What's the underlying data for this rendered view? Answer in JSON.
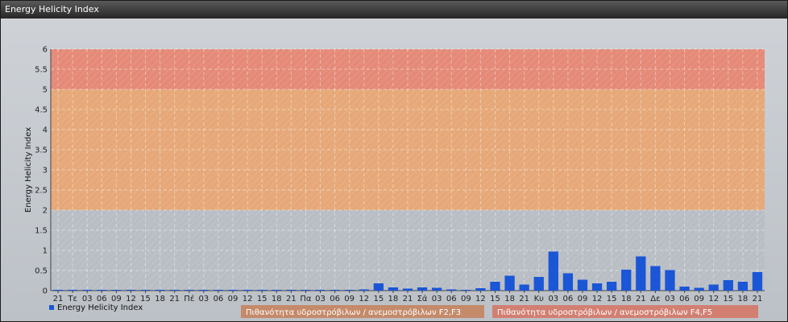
{
  "window": {
    "title": "Energy Helicity Index"
  },
  "chart_data": {
    "type": "bar",
    "ylabel": "Energy Helicity Index",
    "ylim": [
      0,
      6
    ],
    "yticks": [
      "0",
      "0.5",
      "1",
      "1.5",
      "2",
      "2.5",
      "3",
      "3.5",
      "4",
      "4.5",
      "5",
      "5.5",
      "6"
    ],
    "grid": true,
    "categories": [
      "21",
      "Τε",
      "03",
      "06",
      "09",
      "12",
      "15",
      "18",
      "21",
      "Πέ",
      "03",
      "06",
      "09",
      "12",
      "15",
      "18",
      "21",
      "Πα",
      "03",
      "06",
      "09",
      "12",
      "15",
      "18",
      "21",
      "Σά",
      "03",
      "06",
      "09",
      "12",
      "15",
      "18",
      "21",
      "Κυ",
      "03",
      "06",
      "09",
      "12",
      "15",
      "18",
      "21",
      "Δε",
      "03",
      "06",
      "09",
      "12",
      "15",
      "18",
      "21"
    ],
    "series": [
      {
        "name": "Energy Helicity Index",
        "color": "#1a56d6",
        "values": [
          0.02,
          0.02,
          0.02,
          0.02,
          0.02,
          0.02,
          0.02,
          0.02,
          0.02,
          0.02,
          0.02,
          0.02,
          0.02,
          0.02,
          0.02,
          0.02,
          0.02,
          0.02,
          0.02,
          0.02,
          0.02,
          0.03,
          0.18,
          0.08,
          0.05,
          0.08,
          0.07,
          0.03,
          0.02,
          0.06,
          0.22,
          0.37,
          0.15,
          0.34,
          0.97,
          0.43,
          0.27,
          0.18,
          0.22,
          0.52,
          0.85,
          0.61,
          0.51,
          0.1,
          0.07,
          0.15,
          0.26,
          0.22,
          0.46
        ]
      }
    ],
    "zones": [
      {
        "from": 5,
        "to": 6,
        "color": "#e58a78"
      },
      {
        "from": 2,
        "to": 5,
        "color": "#e6a878"
      }
    ],
    "legend": {
      "placement": "bottom-left"
    },
    "zone_labels": [
      {
        "text": "Πιθανότητα υδροστρόβιλων / ανεμοστρόβιλων F2,F3",
        "color": "#c48a6a"
      },
      {
        "text": "Πιθανότητα υδροστρόβιλων / ανεμοστρόβιλων F4,F5",
        "color": "#d27f72"
      }
    ]
  }
}
